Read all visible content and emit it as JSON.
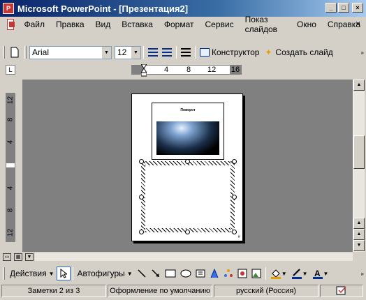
{
  "window": {
    "title": "Microsoft PowerPoint - [Презентация2]",
    "app_icon": "powerpoint-icon"
  },
  "menu": {
    "items": [
      "Файл",
      "Правка",
      "Вид",
      "Вставка",
      "Формат",
      "Сервис",
      "Показ слайдов",
      "Окно",
      "Справка"
    ],
    "close_glyph": "×"
  },
  "toolbar": {
    "font_name": "Arial",
    "font_size": "12",
    "designer_label": "Конструктор",
    "new_slide_label": "Создать слайд"
  },
  "hruler": {
    "ticks": [
      "4",
      "8",
      "12",
      "16"
    ]
  },
  "vruler": {
    "ticks": [
      "12",
      "8",
      "4",
      "4",
      "8",
      "12"
    ]
  },
  "slide": {
    "title": "Поворот"
  },
  "drawing_toolbar": {
    "actions_label": "Действия",
    "autoshapes_label": "Автофигуры"
  },
  "status": {
    "notes": "Заметки 2 из 3",
    "design": "Оформление по умолчанию",
    "language": "русский (Россия)"
  },
  "colors": {
    "titlebar_start": "#0a246a",
    "titlebar_end": "#a6caf0",
    "workspace": "#808080",
    "chrome": "#d4d0c8"
  }
}
